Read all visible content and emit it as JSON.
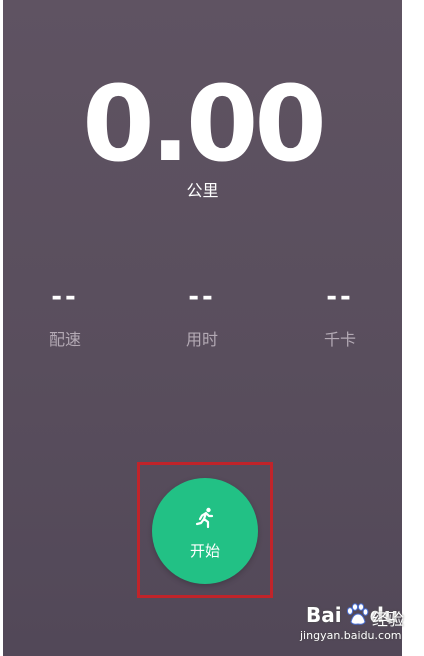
{
  "distance": {
    "value": "0.00",
    "unit": "公里"
  },
  "stats": [
    {
      "value": "--",
      "label": "配速"
    },
    {
      "value": "--",
      "label": "用时"
    },
    {
      "value": "--",
      "label": "千卡"
    }
  ],
  "start_button": {
    "label": "开始",
    "icon": "running-person-icon"
  },
  "watermark": {
    "brand": "Bai",
    "brand_suffix": "du",
    "product": "经验",
    "domain": "jingyan.baidu.com"
  },
  "colors": {
    "background": "#5a4f5e",
    "accent": "#22c185",
    "highlight": "#c0242a"
  }
}
